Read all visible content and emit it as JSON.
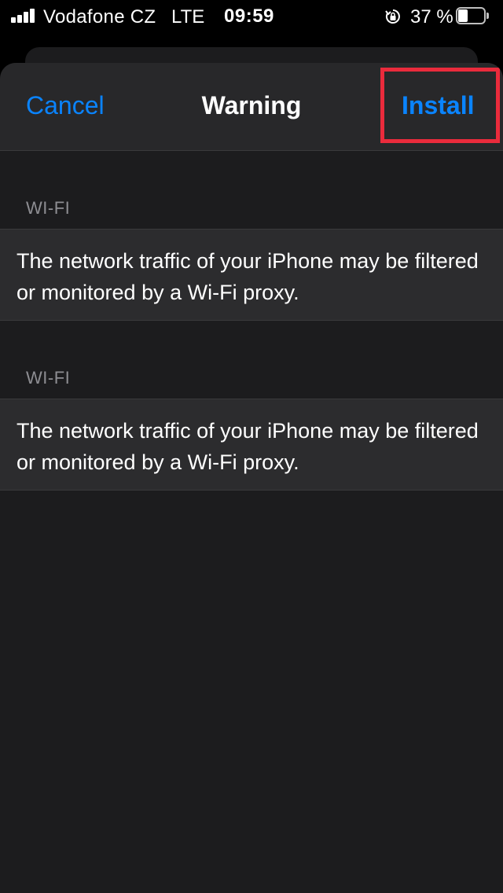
{
  "status_bar": {
    "carrier": "Vodafone CZ",
    "network": "LTE",
    "time": "09:59",
    "battery_percent": "37 %",
    "battery_level": 0.37,
    "icons": [
      "signal-icon",
      "rotation-lock-icon",
      "battery-icon"
    ]
  },
  "nav": {
    "cancel_label": "Cancel",
    "title": "Warning",
    "install_label": "Install"
  },
  "sections": [
    {
      "header": "WI-FI",
      "text": "The network traffic of your iPhone may be filtered or monitored by a Wi-Fi proxy."
    },
    {
      "header": "WI-FI",
      "text": "The network traffic of your iPhone may be filtered or monitored by a Wi-Fi proxy."
    }
  ],
  "colors": {
    "accent": "#0a84ff",
    "highlight": "#ea2b3c",
    "background": "#1c1c1e",
    "cell": "#2c2c2e"
  }
}
